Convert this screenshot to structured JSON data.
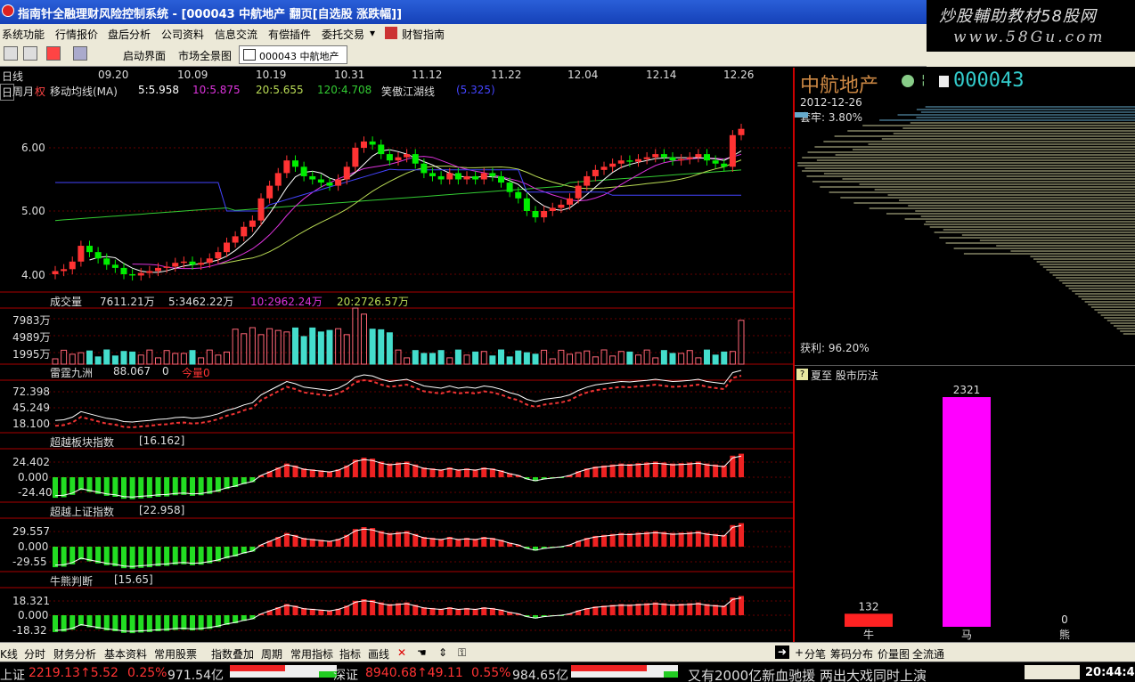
{
  "window": {
    "title": "指南针全融理财风险控制系统 - [000043 中航地产 翻页[自选股 涨跌幅]]",
    "watermark_line1": "炒股輔助教材58股网",
    "watermark_line2": "www.58Gu.com"
  },
  "menu": [
    "系统功能",
    "行情报价",
    "盘后分析",
    "公司资料",
    "信息交流",
    "有偿插件",
    "委托交易",
    "财智指南"
  ],
  "toolbar": {
    "start_label": "启动界面",
    "market_label": "市场全景图",
    "stock_tab": "000043 中航地产"
  },
  "chart": {
    "period_label": "日线",
    "period_tabs": [
      "日",
      "周",
      "月",
      "权"
    ],
    "dates": [
      "09.20",
      "10.09",
      "10.19",
      "10.31",
      "11.12",
      "11.22",
      "12.04",
      "12.14",
      "12.26"
    ],
    "ma_header": {
      "name": "移动均线(MA)",
      "ma5": "5:5.958",
      "ma10": "10:5.875",
      "ma20": "20:5.655",
      "ma120": "120:4.708",
      "extra": "笑傲江湖线",
      "extra_val": "(5.325)"
    },
    "price_axis": [
      "6.00",
      "5.00",
      "4.00"
    ],
    "volume_header": {
      "name": "成交量",
      "vol": "7611.21万",
      "ma5": "5:3462.22万",
      "ma10": "10:2962.24万",
      "ma20": "20:2726.57万"
    },
    "volume_axis": [
      "7983万",
      "4989万",
      "1995万"
    ],
    "leiting": {
      "name": "雷霆九洲",
      "v1": "88.067",
      "v2": "0",
      "v3": "今量0"
    },
    "leiting_axis": [
      "72.398",
      "45.249",
      "18.100"
    ],
    "sector": {
      "name": "超越板块指数",
      "val": "[16.162]"
    },
    "sector_axis": [
      "24.402",
      "0.000",
      "-24.40"
    ],
    "shindex": {
      "name": "超越上证指数",
      "val": "[22.958]"
    },
    "shindex_axis": [
      "29.557",
      "0.000",
      "-29.55"
    ],
    "bullbear": {
      "name": "牛熊判断",
      "val": "[15.65]"
    },
    "bullbear_axis": [
      "18.321",
      "0.000",
      "-18.32"
    ]
  },
  "right_panel": {
    "name": "中航地产",
    "code": "000043",
    "date": "2012-12-26",
    "trapped": "套牢: 3.80%",
    "profit": "获利: 96.20%",
    "almanac_title": "夏至 股市历法",
    "almanac_q": "?"
  },
  "almanac_data": {
    "categories": [
      "牛",
      "马",
      "熊"
    ],
    "values": [
      132,
      2321,
      0
    ],
    "labels": [
      "132",
      "2321",
      "0"
    ]
  },
  "bottom": {
    "left": [
      "K线",
      "分时",
      "财务分析",
      "基本资料",
      "常用股票"
    ],
    "mid": [
      "指数叠加",
      "周期",
      "常用指标",
      "指标",
      "画线"
    ],
    "right": [
      "分笔",
      "筹码分布",
      "价量图",
      "全流通"
    ]
  },
  "status": {
    "sh_label": "上证",
    "sh_value": "2219.13",
    "sh_change": "↑5.52",
    "sh_pct": "0.25%",
    "sh_amount": "971.54亿",
    "sz_label": "深证",
    "sz_value": "8940.68",
    "sz_change": "↑49.11",
    "sz_pct": "0.55%",
    "sz_amount": "984.65亿",
    "news": "又有2000亿新血驰援 两出大戏同时上演",
    "time": "20:44:47"
  },
  "colors": {
    "up": "#ff3333",
    "down": "#54ffff",
    "green_down": "#00ee00",
    "ma5": "#ffffff",
    "ma10": "#dd33dd",
    "ma20": "#bbdd55",
    "ma120": "#33cc33",
    "extra": "#4444ff"
  }
}
